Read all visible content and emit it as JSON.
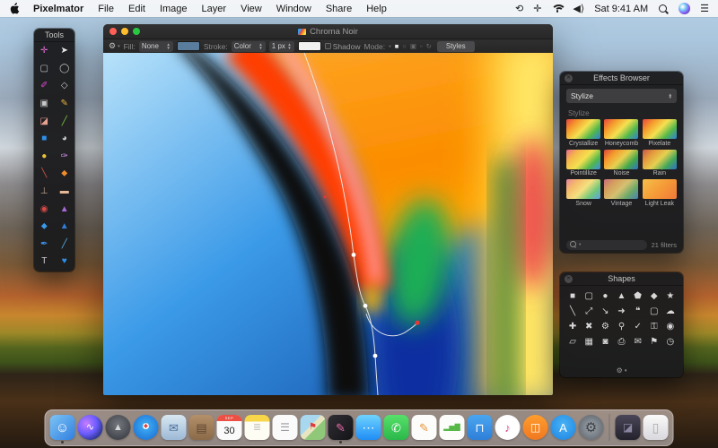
{
  "icons": {
    "gear": "⚙",
    "chevron_down": "▾",
    "close": "✕"
  },
  "menu_bar": {
    "app_name": "Pixelmator",
    "menus": [
      "File",
      "Edit",
      "Image",
      "Layer",
      "View",
      "Window",
      "Share",
      "Help"
    ],
    "status": {
      "clock_icon": "⟲",
      "layout_icon": "✛",
      "time": "Sat 9:41 AM"
    }
  },
  "tools_panel": {
    "title": "Tools",
    "items": [
      {
        "name": "move-tool",
        "glyph": "✛",
        "color": "#e06ad4"
      },
      {
        "name": "arrow-tool",
        "glyph": "➤",
        "color": "#e8e8e8"
      },
      {
        "name": "rect-marquee-tool",
        "glyph": "▢",
        "color": "#c8c8c8"
      },
      {
        "name": "ellipse-marquee-tool",
        "glyph": "◯",
        "color": "#c8c8c8"
      },
      {
        "name": "lasso-tool",
        "glyph": "✐",
        "color": "#d84ad0"
      },
      {
        "name": "polygon-lasso-tool",
        "glyph": "◇",
        "color": "#c8c8c8"
      },
      {
        "name": "transform-tool",
        "glyph": "▣",
        "color": "#c8c8c8"
      },
      {
        "name": "pencil-tool",
        "glyph": "✎",
        "color": "#e8b33c"
      },
      {
        "name": "eraser-tool",
        "glyph": "◪",
        "color": "#e8a090"
      },
      {
        "name": "line-tool",
        "glyph": "╱",
        "color": "#7ac943"
      },
      {
        "name": "paint-bucket-tool",
        "glyph": "■",
        "color": "#2f8fe8"
      },
      {
        "name": "gradient-tool",
        "glyph": "◕",
        "color": "#d0d0d0"
      },
      {
        "name": "dodge-tool",
        "glyph": "●",
        "color": "#e8c33c"
      },
      {
        "name": "brush-tool",
        "glyph": "✑",
        "color": "#cf8fe8"
      },
      {
        "name": "smudge-tool",
        "glyph": "╲",
        "color": "#d85a4a"
      },
      {
        "name": "blur-tool",
        "glyph": "⬥",
        "color": "#f08c2e"
      },
      {
        "name": "clone-stamp-tool",
        "glyph": "⊥",
        "color": "#c8a890"
      },
      {
        "name": "healing-tool",
        "glyph": "▬",
        "color": "#e8b896"
      },
      {
        "name": "red-eye-tool",
        "glyph": "◉",
        "color": "#d84a4a"
      },
      {
        "name": "sharpen-tool",
        "glyph": "▲",
        "color": "#a86ad8"
      },
      {
        "name": "color-drop-tool",
        "glyph": "⬥",
        "color": "#3a9ae8"
      },
      {
        "name": "burn-tool",
        "glyph": "▲",
        "color": "#2f7fd8"
      },
      {
        "name": "pen-tool",
        "glyph": "✒",
        "color": "#3a8fe8"
      },
      {
        "name": "freeform-pen-tool",
        "glyph": "╱",
        "color": "#5ab0e8"
      },
      {
        "name": "type-tool",
        "glyph": "T",
        "color": "#d0d0d0"
      },
      {
        "name": "shape-tool",
        "glyph": "♥",
        "color": "#2f8fe8"
      }
    ]
  },
  "window": {
    "title": "Chroma Noir",
    "toolbar": {
      "fill_label": "Fill:",
      "fill_value": "None",
      "fill_swatch": "#5a7d9e",
      "stroke_label": "Stroke:",
      "stroke_value": "Color",
      "stroke_width": "1 px",
      "stroke_swatch": "#f2f2f0",
      "shadow_label": "Shadow",
      "mode_label": "Mode:",
      "styles_label": "Styles",
      "mode_items": [
        {
          "name": "mode-point-icon",
          "glyph": "•",
          "active": false
        },
        {
          "name": "mode-square-icon",
          "glyph": "■",
          "active": true
        },
        {
          "name": "mode-circle-icon",
          "glyph": "○",
          "active": false
        },
        {
          "name": "mode-duplicate-icon",
          "glyph": "▣",
          "active": false
        },
        {
          "name": "mode-small-square-icon",
          "glyph": "▫",
          "active": false
        },
        {
          "name": "mode-rotate-icon",
          "glyph": "↻",
          "active": false
        }
      ]
    }
  },
  "effects_browser": {
    "title": "Effects Browser",
    "category_value": "Stylize",
    "section_label": "Stylize",
    "effects": [
      {
        "label": "Crystallize",
        "colors": [
          "#e8453c",
          "#f59b2d",
          "#f5e050",
          "#52b84a",
          "#2f7fd8"
        ]
      },
      {
        "label": "Honeycomb",
        "colors": [
          "#e8453c",
          "#f59b2d",
          "#f5e050",
          "#52b84a",
          "#2f7fd8"
        ]
      },
      {
        "label": "Pixelate",
        "colors": [
          "#e8453c",
          "#f59b2d",
          "#f5e050",
          "#52b84a",
          "#2f7fd8"
        ]
      },
      {
        "label": "Pointillize",
        "colors": [
          "#e86a8c",
          "#f5b94a",
          "#f5e050",
          "#52b84a",
          "#3a8fe8"
        ]
      },
      {
        "label": "Noise",
        "colors": [
          "#d8453c",
          "#f59b2d",
          "#e8d050",
          "#42a84a",
          "#2f6fc8"
        ]
      },
      {
        "label": "Rain",
        "colors": [
          "#c8554c",
          "#e59b3d",
          "#e5d050",
          "#42a85a",
          "#2f6fc8"
        ]
      },
      {
        "label": "Snow",
        "colors": [
          "#e8859c",
          "#f5bb6a",
          "#f5e080",
          "#72c87a",
          "#5a9fe8"
        ]
      },
      {
        "label": "Vintage",
        "colors": [
          "#c86a7c",
          "#d5a05d",
          "#d5c070",
          "#6aa86a",
          "#4a7fb8"
        ]
      },
      {
        "label": "Light Leak",
        "colors": [
          "#f5c04a",
          "#f59b38",
          "#f07838"
        ]
      }
    ],
    "footer": {
      "count": "21 filters"
    }
  },
  "shapes_panel": {
    "title": "Shapes",
    "shapes": [
      {
        "name": "square-shape",
        "glyph": "■"
      },
      {
        "name": "rounded-square-shape",
        "glyph": "▢"
      },
      {
        "name": "circle-shape",
        "glyph": "●"
      },
      {
        "name": "triangle-shape",
        "glyph": "▲"
      },
      {
        "name": "pentagon-shape",
        "glyph": "⬟"
      },
      {
        "name": "diamond-shape",
        "glyph": "◆"
      },
      {
        "name": "star-shape",
        "glyph": "★"
      },
      {
        "name": "line-shape",
        "glyph": "╲"
      },
      {
        "name": "double-arrow-shape",
        "glyph": "⤢"
      },
      {
        "name": "diagonal-arrow-shape",
        "glyph": "↘"
      },
      {
        "name": "right-arrow-shape",
        "glyph": "➜"
      },
      {
        "name": "speech-bubble-shape",
        "glyph": "❝"
      },
      {
        "name": "callout-shape",
        "glyph": "▢"
      },
      {
        "name": "cloud-shape",
        "glyph": "☁"
      },
      {
        "name": "plus-shape",
        "glyph": "✚"
      },
      {
        "name": "cross-shape",
        "glyph": "✖"
      },
      {
        "name": "gear-shape",
        "glyph": "⚙"
      },
      {
        "name": "magnifier-shape",
        "glyph": "⚲"
      },
      {
        "name": "checkmark-shape",
        "glyph": "✓"
      },
      {
        "name": "lock-shape",
        "glyph": "⚿"
      },
      {
        "name": "eye-shape",
        "glyph": "◉"
      },
      {
        "name": "folder-shape",
        "glyph": "▱"
      },
      {
        "name": "image-shape",
        "glyph": "▦"
      },
      {
        "name": "camera-shape",
        "glyph": "◙"
      },
      {
        "name": "display-shape",
        "glyph": "⎙"
      },
      {
        "name": "mail-shape",
        "glyph": "✉"
      },
      {
        "name": "bookmark-shape",
        "glyph": "⚑"
      },
      {
        "name": "clock-shape",
        "glyph": "◷"
      }
    ]
  },
  "dock": {
    "items": [
      {
        "name": "dock-finder",
        "shape": "rounded",
        "bg": "linear-gradient(135deg,#7ec4f5 0%,#2f7fe0 100%)",
        "glyph": "☺",
        "glyph_color": "#ffffff",
        "glyph_size": 15,
        "running": true
      },
      {
        "name": "dock-siri",
        "shape": "circle",
        "bg": "radial-gradient(circle at 35% 35%, #c77dff, #6a5cff 45%, #1b2a6b 85%)",
        "glyph": "∿",
        "glyph_color": "#ffffff",
        "glyph_size": 11,
        "running": false
      },
      {
        "name": "dock-launchpad",
        "shape": "circle",
        "bg": "radial-gradient(circle at 50% 40%, #75797f, #3d4046 80%)",
        "glyph": "▲",
        "glyph_color": "#d8d8d8",
        "glyph_size": 11,
        "running": false
      },
      {
        "name": "dock-safari",
        "shape": "circle",
        "bg": "radial-gradient(circle at 50% 45%, #ffffff 0 16%, #3aa6f0 17%, #1b6fd4 90%)",
        "glyph": "✦",
        "glyph_color": "#e03a3a",
        "glyph_size": 10,
        "running": false
      },
      {
        "name": "dock-mail",
        "shape": "rounded",
        "bg": "linear-gradient(180deg,#d8e8f2,#9db9d6)",
        "glyph": "✉",
        "glyph_color": "#4a6e9e",
        "glyph_size": 13,
        "running": false
      },
      {
        "name": "dock-contacts",
        "shape": "rounded",
        "bg": "linear-gradient(180deg,#b4906a,#8a6a48)",
        "glyph": "▤",
        "glyph_color": "#5e4630",
        "glyph_size": 13,
        "running": false
      },
      {
        "name": "dock-calendar",
        "shape": "rounded",
        "bg": "#fafafa",
        "month": "SEP",
        "day": "30",
        "running": false
      },
      {
        "name": "dock-notes",
        "shape": "rounded",
        "bg": "linear-gradient(180deg,#f7d64a 0 26%,#fdfdf4 26%)",
        "glyph": "≣",
        "glyph_color": "#c8c8c0",
        "glyph_size": 11,
        "running": false
      },
      {
        "name": "dock-reminders",
        "shape": "rounded",
        "bg": "#fafafa",
        "glyph": "☰",
        "glyph_color": "#9a9aa0",
        "glyph_size": 12,
        "running": false
      },
      {
        "name": "dock-maps",
        "shape": "rounded",
        "bg": "linear-gradient(135deg,#a8d8f0 0 42%,#e8e4c0 42% 58%,#8fc878 58%)",
        "glyph": "⚑",
        "glyph_color": "#e03a3a",
        "glyph_size": 10,
        "running": false
      },
      {
        "name": "dock-pixelmator",
        "shape": "rounded",
        "bg": "linear-gradient(135deg,#2e2e34,#141418)",
        "glyph": "✎",
        "glyph_color": "#e86aa8",
        "glyph_size": 13,
        "running": true
      },
      {
        "name": "dock-messages",
        "shape": "rounded",
        "bg": "linear-gradient(180deg,#6fd3ff,#1f8df5)",
        "glyph": "⋯",
        "glyph_color": "#ffffff",
        "glyph_size": 14,
        "running": false
      },
      {
        "name": "dock-facetime",
        "shape": "rounded",
        "bg": "linear-gradient(180deg,#57e06a,#2ab84a)",
        "glyph": "✆",
        "glyph_color": "#ffffff",
        "glyph_size": 13,
        "running": false
      },
      {
        "name": "dock-pages",
        "shape": "rounded",
        "bg": "#fcfcfa",
        "glyph": "✎",
        "glyph_color": "#e8963c",
        "glyph_size": 13,
        "running": false
      },
      {
        "name": "dock-numbers",
        "shape": "rounded",
        "bg": "#fcfcfa",
        "glyph": "▂▅▇",
        "glyph_color": "#58b847",
        "glyph_size": 8,
        "running": false
      },
      {
        "name": "dock-keynote",
        "shape": "rounded",
        "bg": "linear-gradient(180deg,#4aa6f0,#2f7fd8)",
        "glyph": "⊓",
        "glyph_color": "#ffffff",
        "glyph_size": 13,
        "running": false
      },
      {
        "name": "dock-itunes",
        "shape": "circle",
        "bg": "radial-gradient(circle,#ffffff 60%,#eeeef2)",
        "glyph": "♪",
        "glyph_color": "#e0458c",
        "glyph_size": 13,
        "running": false
      },
      {
        "name": "dock-ibooks",
        "shape": "circle",
        "bg": "linear-gradient(180deg,#ff9d2e,#f07820)",
        "glyph": "◫",
        "glyph_color": "#ffffff",
        "glyph_size": 12,
        "running": false
      },
      {
        "name": "dock-appstore",
        "shape": "circle",
        "bg": "radial-gradient(circle at 50% 40%,#4ab3f4,#1a82e2)",
        "glyph": "A",
        "glyph_color": "#ffffff",
        "glyph_size": 13,
        "running": false
      },
      {
        "name": "dock-system-preferences",
        "shape": "circle",
        "bg": "radial-gradient(circle,#a0a6ae,#565c62)",
        "glyph": "⚙",
        "glyph_color": "#3a3e44",
        "glyph_size": 15,
        "running": false
      },
      {
        "name": "divider",
        "divider": true
      },
      {
        "name": "dock-documents-stack",
        "shape": "rounded",
        "bg": "linear-gradient(180deg,#4a4658,#23222c)",
        "glyph": "◪",
        "glyph_color": "#8a86a0",
        "glyph_size": 12,
        "running": false
      },
      {
        "name": "dock-trash",
        "shape": "rounded",
        "bg": "linear-gradient(180deg,#fafafa,#d8d8de)",
        "glyph": "▯",
        "glyph_color": "#a8a8ae",
        "glyph_size": 14,
        "running": false
      }
    ]
  }
}
